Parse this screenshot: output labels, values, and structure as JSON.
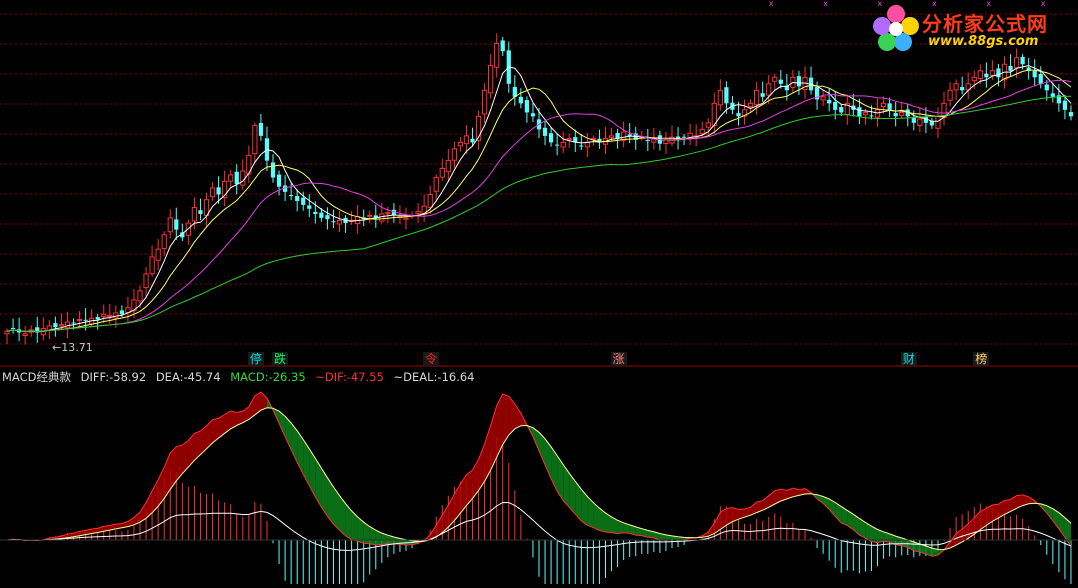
{
  "chart_data": [
    {
      "type": "candlestick",
      "low_label": "←13.71",
      "moving_average_colors": [
        "#ffffff",
        "#ffff66",
        "#e040e0",
        "#2ecc2e"
      ],
      "event_tags": [
        {
          "text": "停",
          "color": "#00e0e0",
          "index": 41
        },
        {
          "text": "跌",
          "color": "#00ff66",
          "index": 45
        },
        {
          "text": "令",
          "color": "#ff2020",
          "index": 70
        },
        {
          "text": "涨",
          "color": "#ff8080",
          "index": 101
        },
        {
          "text": "财",
          "color": "#00e0e0",
          "index": 149
        },
        {
          "text": "榜",
          "color": "#ffcc66",
          "index": 161
        }
      ],
      "closes": [
        14.1,
        14.3,
        14.0,
        13.9,
        14.2,
        14.0,
        14.3,
        14.5,
        14.4,
        14.6,
        14.8,
        14.7,
        15.0,
        14.9,
        15.1,
        15.0,
        15.4,
        15.3,
        15.5,
        15.4,
        15.9,
        16.5,
        17.2,
        18.5,
        19.8,
        20.4,
        21.5,
        22.8,
        21.9,
        21.3,
        22.4,
        23.6,
        23.1,
        24.2,
        25.1,
        24.6,
        25.6,
        26.1,
        25.4,
        26.4,
        27.6,
        29.9,
        29.1,
        27.2,
        25.9,
        25.2,
        24.8,
        24.5,
        24.1,
        23.8,
        23.5,
        23.1,
        22.8,
        22.7,
        22.5,
        22.6,
        22.4,
        22.6,
        22.9,
        22.7,
        23.0,
        22.8,
        23.1,
        23.2,
        23.0,
        22.9,
        22.8,
        23.0,
        23.3,
        23.7,
        24.6,
        25.9,
        26.6,
        27.2,
        28.1,
        28.6,
        29.1,
        28.6,
        30.6,
        32.6,
        34.5,
        36.2,
        35.6,
        33.1,
        32.1,
        31.6,
        30.9,
        30.6,
        29.6,
        29.1,
        28.6,
        28.4,
        28.6,
        28.9,
        28.6,
        28.3,
        28.6,
        28.9,
        28.7,
        28.9,
        29.1,
        28.9,
        29.4,
        29.1,
        28.8,
        29.0,
        28.7,
        28.9,
        28.5,
        28.8,
        29.0,
        28.8,
        29.0,
        29.3,
        29.1,
        29.6,
        30.1,
        31.6,
        32.6,
        31.6,
        31.1,
        30.6,
        31.1,
        31.6,
        32.6,
        32.1,
        33.1,
        33.6,
        33.1,
        32.6,
        33.6,
        32.9,
        33.6,
        32.6,
        31.9,
        32.1,
        31.6,
        31.1,
        30.9,
        31.6,
        31.1,
        30.6,
        30.9,
        30.6,
        31.1,
        31.6,
        31.1,
        30.6,
        30.9,
        30.6,
        30.1,
        30.4,
        30.1,
        29.9,
        30.6,
        31.6,
        32.6,
        33.1,
        32.6,
        33.1,
        33.6,
        34.1,
        33.6,
        34.1,
        33.6,
        34.6,
        34.1,
        35.1,
        34.6,
        34.1,
        33.6,
        33.1,
        32.6,
        32.1,
        31.6,
        31.1,
        30.6
      ]
    },
    {
      "type": "macd",
      "title": "MACD经典款",
      "values": {
        "DIFF": {
          "text": "DIFF:-58.92",
          "color": "#d8d8d8"
        },
        "DEA": {
          "text": "DEA:-45.74",
          "color": "#d8d8d8"
        },
        "MACD": {
          "text": "MACD:-26.35",
          "color": "#33dd33"
        },
        "DIF2": {
          "text": "~DIF:-47.55",
          "color": "#ff3030"
        },
        "DEAL": {
          "text": "~DEAL:-16.64",
          "color": "#d8d8d8"
        }
      }
    }
  ],
  "watermark": {
    "brand": "分析家公式网",
    "url": "www.88gs.com"
  },
  "colors": {
    "up": "#ff3030",
    "down": "#54ffff",
    "grid": "#8b0000",
    "divider": "#a00000"
  }
}
